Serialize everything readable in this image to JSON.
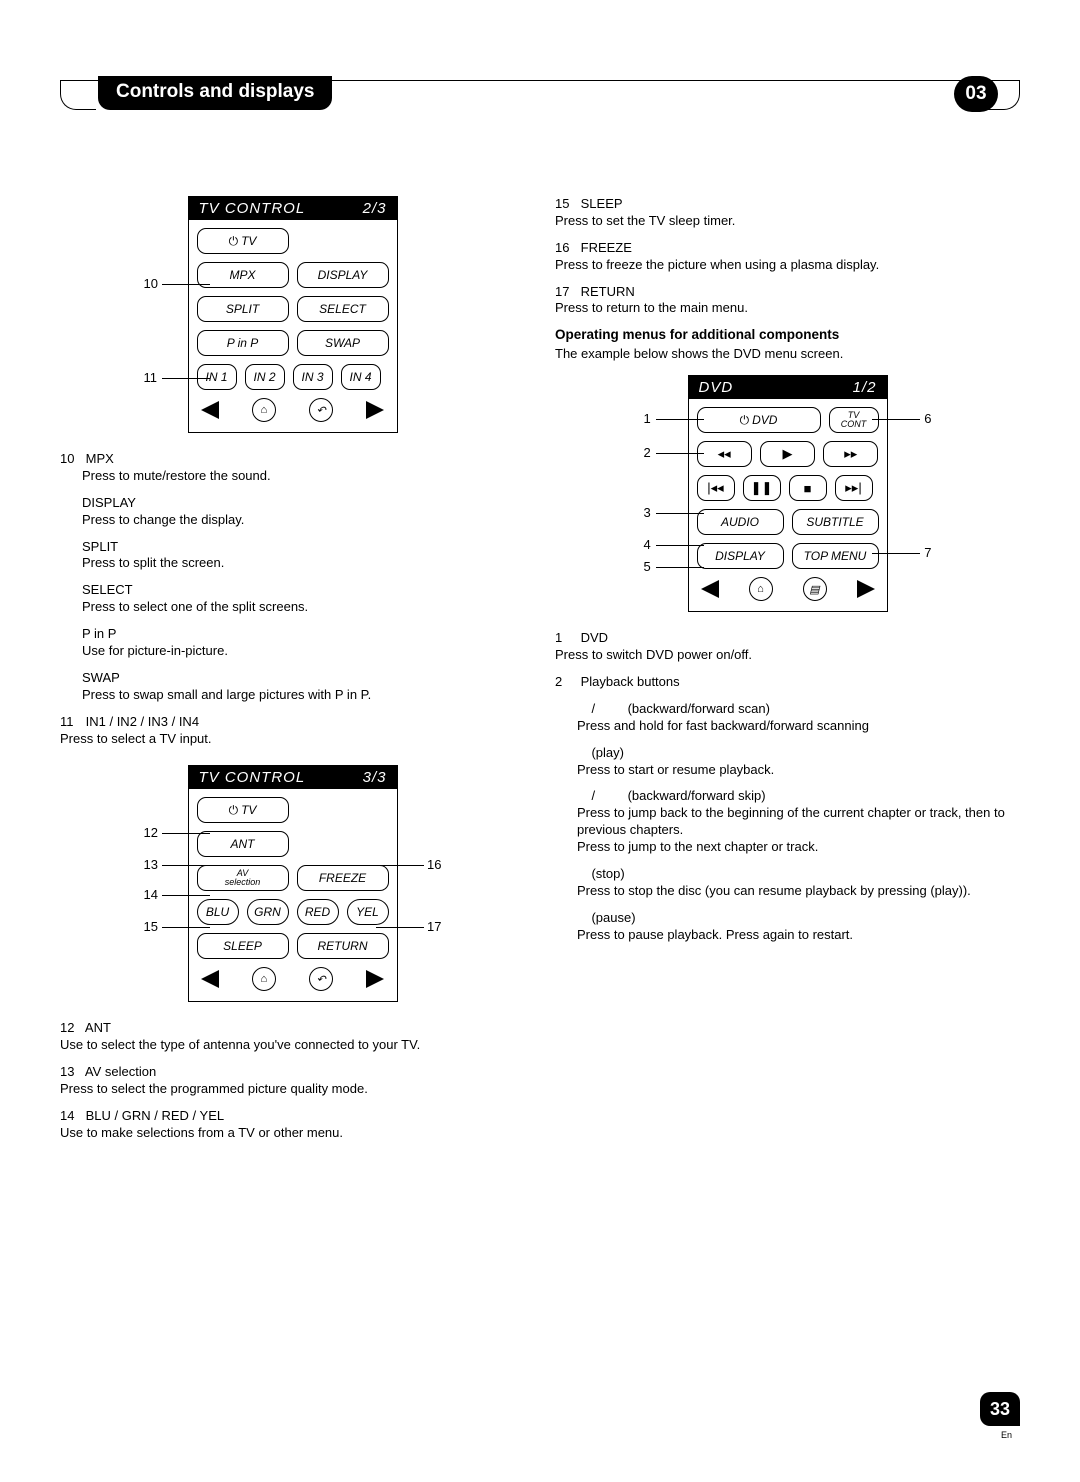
{
  "header": {
    "title": "Controls and displays",
    "chapter": "03"
  },
  "remote1": {
    "header_left": "TV CONTROL",
    "header_right": "2/3",
    "tv": "TV",
    "mpx": "MPX",
    "display": "DISPLAY",
    "split": "SPLIT",
    "select": "SELECT",
    "pinp": "P in P",
    "swap": "SWAP",
    "in1": "IN 1",
    "in2": "IN 2",
    "in3": "IN 3",
    "in4": "IN 4"
  },
  "remote2": {
    "header_left": "TV CONTROL",
    "header_right": "3/3",
    "tv": "TV",
    "ant": "ANT",
    "av_sel_1": "AV",
    "av_sel_2": "selection",
    "freeze": "FREEZE",
    "blu": "BLU",
    "grn": "GRN",
    "red": "RED",
    "yel": "YEL",
    "sleep": "SLEEP",
    "return": "RETURN"
  },
  "remote3": {
    "header_left": "DVD",
    "header_right": "1/2",
    "dvd": "DVD",
    "tv_cont_1": "TV",
    "tv_cont_2": "CONT",
    "audio": "AUDIO",
    "subtitle": "SUBTITLE",
    "display": "DISPLAY",
    "topmenu": "TOP MENU"
  },
  "callouts": {
    "c10": "10",
    "c11": "11",
    "c12": "12",
    "c13": "13",
    "c14": "14",
    "c15": "15",
    "c16": "16",
    "c17": "17",
    "d1": "1",
    "d2": "2",
    "d3": "3",
    "d4": "4",
    "d5": "5",
    "d6": "6",
    "d7": "7"
  },
  "left_entries": {
    "e10_num": "10",
    "e10_mpx_label": "MPX",
    "e10_mpx_desc": "Press to mute/restore the sound.",
    "e10_display_label": "DISPLAY",
    "e10_display_desc": "Press to change the display.",
    "e10_split_label": "SPLIT",
    "e10_split_desc": "Press to split the screen.",
    "e10_select_label": "SELECT",
    "e10_select_desc": "Press to select one of the split screens.",
    "e10_pinp_label": "P in P",
    "e10_pinp_desc": "Use for picture-in-picture.",
    "e10_swap_label": "SWAP",
    "e10_swap_desc": "Press to swap small and large pictures with P in P.",
    "e11_num": "11",
    "e11_label": "IN1 / IN2 / IN3 / IN4",
    "e11_desc": "Press to select a TV input.",
    "e12_num": "12",
    "e12_label": "ANT",
    "e12_desc": "Use to select the type of antenna you've connected to your TV.",
    "e13_num": "13",
    "e13_label": "AV selection",
    "e13_desc": "Press to select the programmed picture quality mode.",
    "e14_num": "14",
    "e14_label": "BLU / GRN / RED / YEL",
    "e14_desc": "Use to make selections from a TV or other menu."
  },
  "right_entries": {
    "e15_num": "15",
    "e15_label": "SLEEP",
    "e15_desc": "Press to set the TV sleep timer.",
    "e16_num": "16",
    "e16_label": "FREEZE",
    "e16_desc": "Press to freeze the picture when using a plasma display.",
    "e17_num": "17",
    "e17_label": "RETURN",
    "e17_desc": "Press to return to the main menu.",
    "subheading": "Operating menus for additional components",
    "subdesc": "The example below shows the DVD menu screen.",
    "d1_num": "1",
    "d1_label": "    DVD",
    "d1_desc": "Press to switch DVD power on/off.",
    "d2_num": "2",
    "d2_label": "Playback buttons",
    "pb_scan_label": "    /         (backward/forward scan)",
    "pb_scan_desc": "Press and hold for fast backward/forward scanning",
    "pb_play_label": "    (play)",
    "pb_play_desc": "Press to start or resume playback.",
    "pb_skip_label": "    /         (backward/forward skip)",
    "pb_skip_desc1": "Press        to jump back to the beginning of the current chapter or track, then to previous chapters.",
    "pb_skip_desc2": "Press        to jump to the next chapter or track.",
    "pb_stop_label": "    (stop)",
    "pb_stop_desc": "Press to stop the disc (you can resume playback by pressing       (play)).",
    "pb_pause_label": "    (pause)",
    "pb_pause_desc": "Press to pause playback. Press again to restart."
  },
  "footer": {
    "page": "33",
    "lang": "En"
  }
}
